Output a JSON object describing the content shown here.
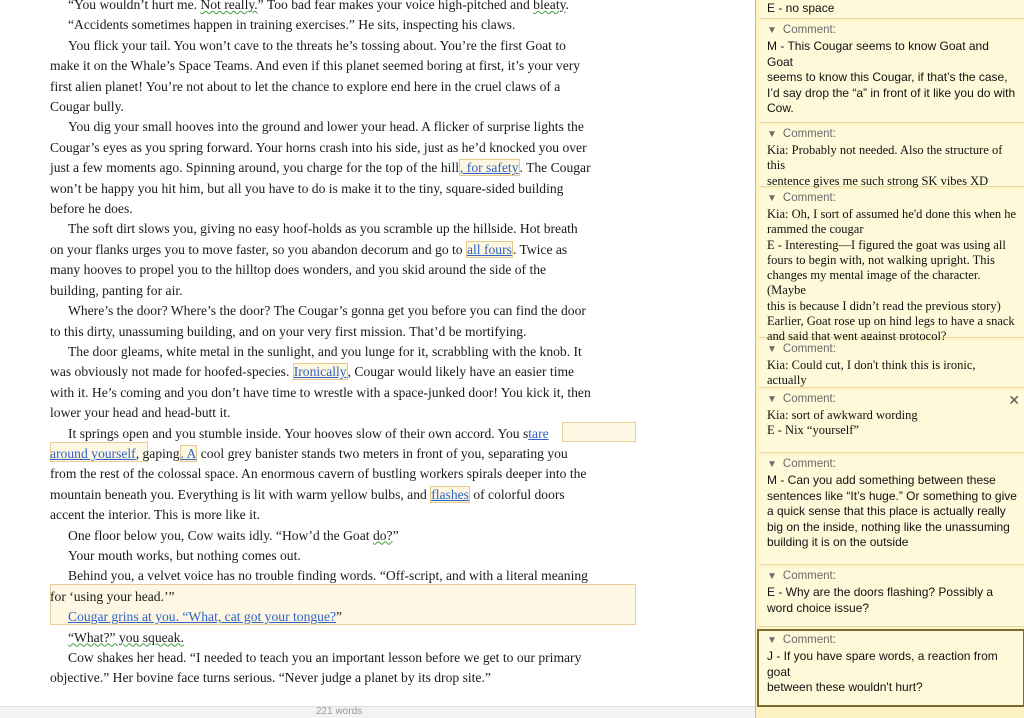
{
  "document": {
    "paragraphs": [
      [
        "“You wouldn’t hurt me. ",
        {
          "t": "Not really.",
          "c": "squig"
        },
        "” Too bad fear makes your voice high-pitched and ",
        {
          "t": "bleaty",
          "c": "squig"
        },
        "."
      ],
      [
        "“Accidents sometimes happen in training exercises.” He sits, inspecting his claws."
      ],
      [
        "You flick your tail. You won’t cave to the threats he’s tossing about. You’re the first Goat to"
      ],
      [
        "make it on the Whale’s Space Teams. And even if this planet seemed boring at first, it’s your very"
      ],
      [
        "first alien planet! You’re not about to let the chance to explore end here in the cruel claws of a"
      ],
      [
        "Cougar bully."
      ],
      [
        "You dig your small hooves into the ground and lower your head. A flicker of surprise lights the"
      ],
      [
        "Cougar’s eyes as you spring forward. Your horns crash into his side, just as he’d knocked you over"
      ],
      [
        "just a few moments ago. Spinning around, you charge for the top of the hill",
        {
          "t": ", for safety",
          "c": "hl"
        },
        ". The Cougar"
      ],
      [
        "won’t be happy you hit him, but all you have to do is make it to the tiny, square-sided building"
      ],
      [
        "before he does."
      ],
      [
        "The soft dirt slows you, giving no easy hoof-holds as you scramble up the hillside. Hot breath"
      ],
      [
        "on your flanks urges you to move faster, so you abandon decorum and go to ",
        {
          "t": "all fours",
          "c": "hl"
        },
        ". Twice as"
      ],
      [
        "many hooves to propel you to the hilltop does wonders, and you skid around the side of the"
      ],
      [
        "building, panting for air."
      ],
      [
        "Where’s the door? Where’s the door? The Cougar’s gonna get you before you can find the door"
      ],
      [
        "to this dirty, unassuming building, and on your very first mission. That’d be mortifying."
      ],
      [
        "The door gleams, white metal in the sunlight, and you lunge for it, scrabbling with the knob. It"
      ],
      [
        "was obviously not made for hoofed-species. ",
        {
          "t": "Ironically",
          "c": "hl"
        },
        ", Cougar would likely have an easier time"
      ],
      [
        "with it. He’s coming and you don’t have time to wrestle with a space-junked door! You kick it, then"
      ],
      [
        "lower your head and head-butt it."
      ],
      [
        "It springs open and you stumble inside. Your hooves slow of their own accord. You s",
        {
          "t": "tare",
          "c": "blue"
        }
      ],
      [
        {
          "t": "around yourself",
          "c": "blue"
        },
        ", gaping",
        {
          "t": ". A",
          "c": "hl"
        },
        " cool grey banister stands two meters in front of you, separating you"
      ],
      [
        "from the rest of the colossal space. An enormous cavern of bustling workers spirals deeper into the"
      ],
      [
        "mountain beneath you. Everything is lit with warm yellow bulbs, and ",
        {
          "t": "flashes",
          "c": "hl"
        },
        " of colorful doors"
      ],
      [
        "accent the interior. This is more like it."
      ],
      [
        "One floor below you, Cow waits idly. “How’d the Goat ",
        {
          "t": "do?",
          "c": "squig"
        },
        "”"
      ],
      [
        "Your mouth works, but nothing comes out."
      ],
      [
        "Behind you, a velvet voice has no trouble finding words. “Off-script, and with a literal meaning"
      ],
      [
        "for ‘using your head.’”"
      ],
      [
        {
          "t": "Cougar grins at you. “What, cat got your tongue?",
          "c": "blue"
        },
        "”"
      ],
      [
        {
          "t": "“What?” you squeak.",
          "c": "squig"
        }
      ],
      [
        "Cow shakes her head. “I needed to teach you an important lesson before we get to our primary"
      ],
      [
        "objective.” Her bovine face turns serious. “Never judge a planet by its drop site.”"
      ]
    ],
    "status": "221 words"
  },
  "comments": {
    "top_fragment": "E - no space",
    "header_label": "Comment:",
    "items": [
      {
        "font": "sans",
        "lines": [
          "M - This Cougar seems to know Goat and Goat",
          "seems to know this Cougar, if that’s the case,",
          "I’d say drop the “a” in front of it like you do with",
          "Cow."
        ]
      },
      {
        "font": "serif",
        "lines": [
          "Kia: Probably not needed. Also the structure of this",
          "sentence gives me such strong SK vibes XD"
        ]
      },
      {
        "font": "serif",
        "lines": [
          "Kia: Oh, I sort of assumed he'd done this when he",
          "rammed the cougar",
          "E - Interesting—I figured the goat was using all",
          "fours to begin with, not walking upright. This",
          "changes my mental image of the character. (Maybe",
          "this is because I didn’t read the previous story)",
          "Earlier, Goat rose up on hind legs to have a snack",
          "and said that went against protocol?"
        ]
      },
      {
        "font": "serif",
        "lines": [
          "Kia: Could cut, I don't think this is ironic, actually"
        ]
      },
      {
        "font": "serif",
        "lines": [
          "Kia: sort of awkward wording",
          "E - Nix “yourself”"
        ]
      },
      {
        "font": "sans",
        "lines": [
          "M - Can you add something between these",
          "sentences like “It’s huge.” Or something to give",
          "a quick sense that this place is actually really",
          "big on the inside, nothing like the unassuming",
          "building it is on the outside"
        ]
      },
      {
        "font": "sans",
        "lines": [
          "E - Why are the doors flashing? Possibly a",
          "word choice issue?"
        ]
      },
      {
        "font": "sans",
        "lines": [
          "J - If you have spare words, a reaction from goat",
          "between these wouldn't hurt?"
        ]
      }
    ]
  }
}
